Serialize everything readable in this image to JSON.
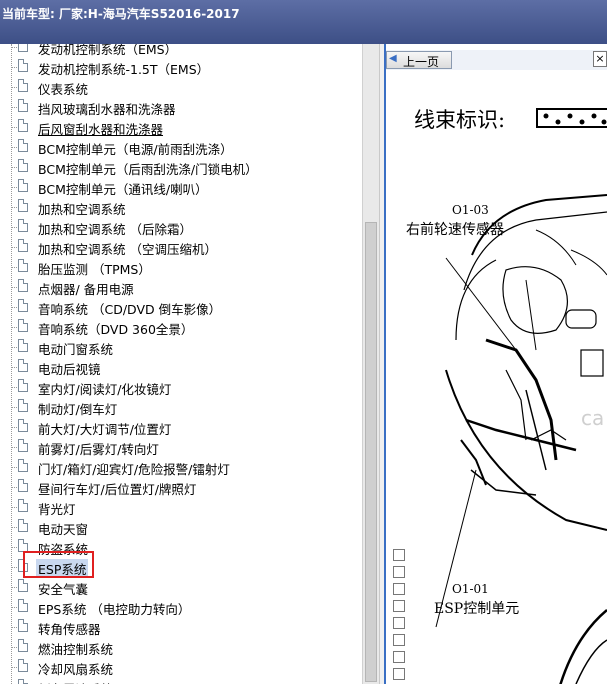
{
  "window": {
    "title": "当前车型:   厂家:H-海马汽车S52016-2017"
  },
  "tree": {
    "selected_index": 26,
    "items": [
      {
        "label": "发动机控制系统（EMS）"
      },
      {
        "label": "发动机控制系统-1.5T（EMS）"
      },
      {
        "label": "仪表系统"
      },
      {
        "label": "挡风玻璃刮水器和洗涤器"
      },
      {
        "label": "后风窗刮水器和洗涤器",
        "underline": true
      },
      {
        "label": "BCM控制单元（电源/前雨刮洗涤）"
      },
      {
        "label": "BCM控制单元（后雨刮洗涤/门锁电机）"
      },
      {
        "label": "BCM控制单元（通讯线/喇叭）"
      },
      {
        "label": "加热和空调系统"
      },
      {
        "label": "加热和空调系统 （后除霜）"
      },
      {
        "label": "加热和空调系统 （空调压缩机）"
      },
      {
        "label": "胎压监测 （TPMS）"
      },
      {
        "label": "点烟器/ 备用电源"
      },
      {
        "label": "音响系统 （CD/DVD 倒车影像）"
      },
      {
        "label": "音响系统（DVD 360全景）"
      },
      {
        "label": "电动门窗系统"
      },
      {
        "label": "电动后视镜"
      },
      {
        "label": "室内灯/阅读灯/化妆镜灯"
      },
      {
        "label": "制动灯/倒车灯"
      },
      {
        "label": "前大灯/大灯调节/位置灯"
      },
      {
        "label": "前雾灯/后雾灯/转向灯"
      },
      {
        "label": "门灯/箱灯/迎宾灯/危险报警/镭射灯"
      },
      {
        "label": "昼间行车灯/后位置灯/牌照灯"
      },
      {
        "label": "背光灯"
      },
      {
        "label": "电动天窗"
      },
      {
        "label": "防盗系统"
      },
      {
        "label": "ESP系统"
      },
      {
        "label": "安全气囊"
      },
      {
        "label": "EPS系统 （电控助力转向）"
      },
      {
        "label": "转角传感器"
      },
      {
        "label": "燃油控制系统"
      },
      {
        "label": "冷却风扇系统"
      },
      {
        "label": "倒车雷达系统"
      }
    ]
  },
  "viewer": {
    "prev_label": "上一页",
    "close_glyph": "×",
    "harness_title": "线束标识:",
    "callouts": [
      {
        "code": "O1-03",
        "name": "右前轮速传感器"
      },
      {
        "code": "O1-01",
        "name": "ESP控制单元"
      }
    ],
    "watermark": "ca"
  },
  "icons": {
    "document": "document-icon",
    "prev_arrow": "arrow-left-icon",
    "close": "close-icon"
  },
  "colors": {
    "titlebar": "#4a5a94",
    "selection_box": "#e02020",
    "viewer_border": "#3a6fc4"
  }
}
